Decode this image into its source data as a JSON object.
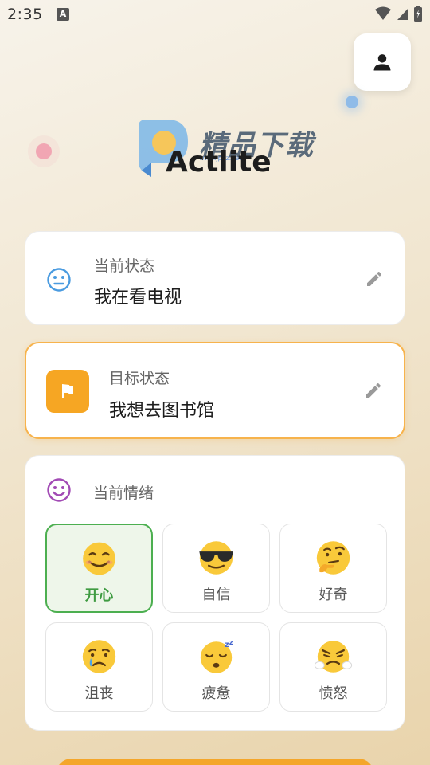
{
  "status_bar": {
    "time": "2:35",
    "notification_glyph": "A"
  },
  "app": {
    "title": "Actlite",
    "watermark_text": "精品下载",
    "watermark_url": "www.jpxz.net"
  },
  "current_status": {
    "label": "当前状态",
    "value": "我在看电视"
  },
  "target_status": {
    "label": "目标状态",
    "value": "我想去图书馆"
  },
  "emotion": {
    "label": "当前情绪",
    "moods": [
      {
        "label": "开心",
        "emoji": "😊",
        "selected": true
      },
      {
        "label": "自信",
        "emoji": "😎",
        "selected": false
      },
      {
        "label": "好奇",
        "emoji": "🤔",
        "selected": false
      },
      {
        "label": "沮丧",
        "emoji": "😢",
        "selected": false
      },
      {
        "label": "疲惫",
        "emoji": "😴",
        "selected": false
      },
      {
        "label": "愤怒",
        "emoji": "😤",
        "selected": false
      }
    ]
  },
  "colors": {
    "accent_orange": "#f6a623",
    "selected_green": "#4caf50",
    "emotion_purple": "#a24bb5",
    "status_blue": "#4a9be0"
  }
}
